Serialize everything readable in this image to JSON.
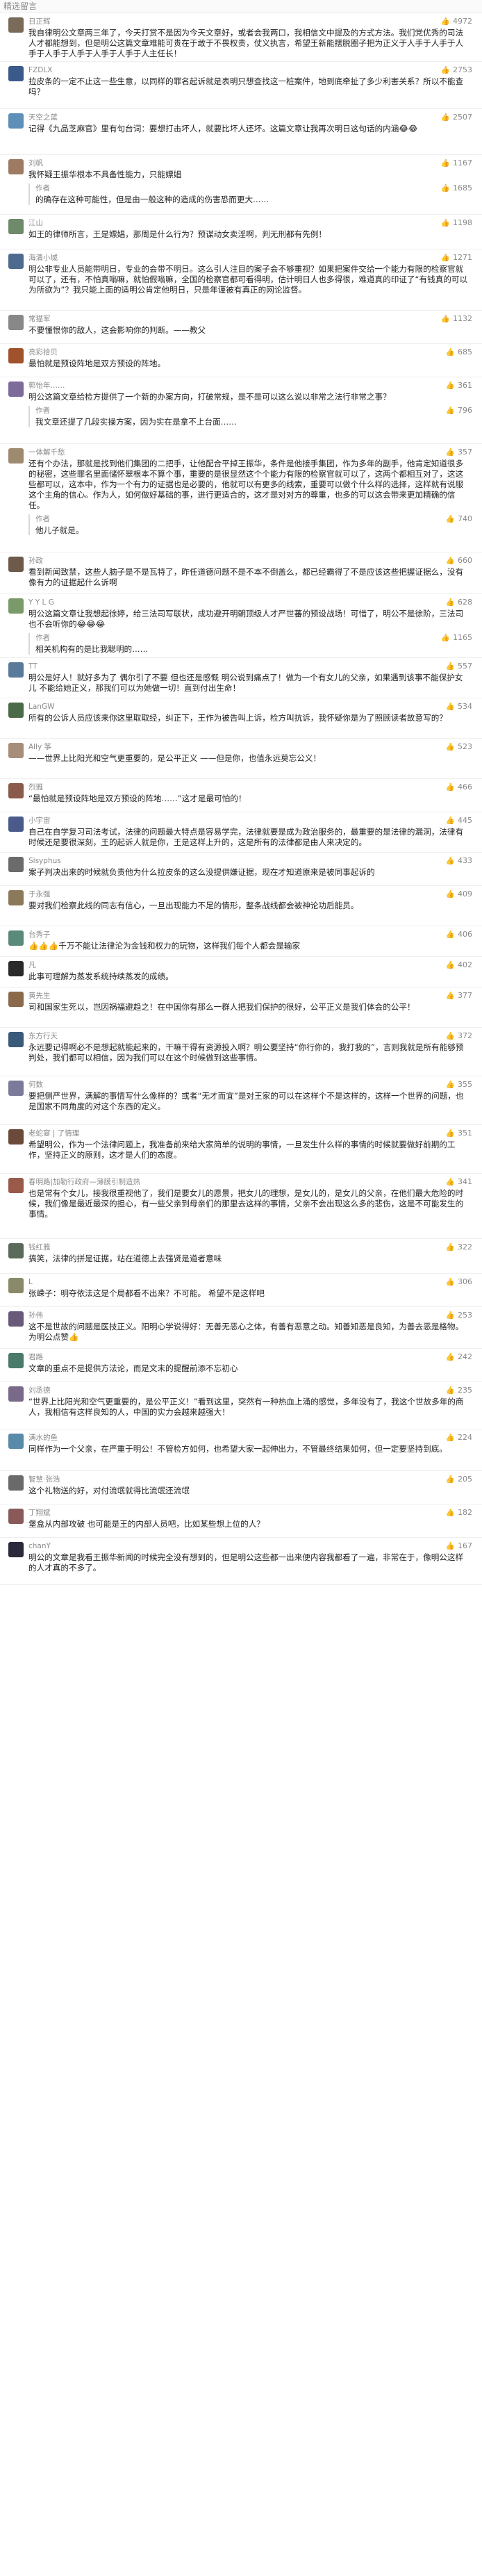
{
  "header": {
    "title": "精选留言"
  },
  "comments": [
    {
      "nick": "日正辉",
      "likes": "4972",
      "color": "#7a6a5a",
      "h": 60,
      "text": "我自律明公文章两三年了，今天打赏不是因为今天文章好，或者会我两口，我相信文中提及的方式方法。我们党优秀的司法人才都能想到，但是明公这篇文章难能可贵在于敢于不畏权贵，仗义执言，希望王新能摆脱圈子把为正义于人手于人手于人手于人手于人手于人手于人手于人主任长！"
    },
    {
      "nick": "FZDLX",
      "likes": "2753",
      "color": "#3b5a8c",
      "h": 60,
      "text": "拉皮条的一定不止这一些生意，以同样的罪名起诉就是表明只想查找这一桩案件，地到底牵扯了多少利害关系？所以不能查吗？"
    },
    {
      "nick": "天空之蓝",
      "likes": "2507",
      "color": "#5e8fb8",
      "h": 60,
      "text": "记得《九品芝麻官》里有句台词：要想打击坏人，就要比坏人还坏。这篇文章让我再次明日这句话的内涵😂😂"
    },
    {
      "nick": "刘帆",
      "likes": "1167",
      "color": "#9c7b62",
      "h": 36,
      "text": "我怀疑王振华根本不具备性能力，只能嫖娼"
    },
    {
      "nick": "作者",
      "likes": "1685",
      "color": "#ffffff",
      "h": 28,
      "text": "的确存在这种可能性，但是由一般这种的造成的伤害恐而更大……"
    },
    {
      "nick": "江山",
      "likes": "1198",
      "color": "#6f8a6a",
      "h": 40,
      "text": "如王的律师所言，王是嫖娼，那周是什么行为？预谋动女卖淫啊，判无刑都有先例！"
    },
    {
      "nick": "海清小城",
      "likes": "1271",
      "color": "#4e6b8f",
      "h": 82,
      "text": "明公非专业人员能带明日，专业的会带不明日。这么引人注目的案子会不够重视？如果把案件交给一个能力有限的检察官就可以了，还有，不怕真嗡嘛，就怕假嗡嘛，全国的检察官都可看得明，估计明日人也多得很，难道真的印证了“有钱真的可以为所欲为”？我只能上面的适明公肯定他明日，只是年谨被有真正的网论监督。"
    },
    {
      "nick": "常猫军",
      "likes": "1132",
      "color": "#888888",
      "h": 36,
      "text": "不要懂恨你的敌人，这会影响你的判断。——教父"
    },
    {
      "nick": "亮彩拾贝",
      "likes": "685",
      "color": "#a0522d",
      "h": 36,
      "text": "最怕就是预设阵地是双方预设的阵地。"
    },
    {
      "nick": "郭怡年……",
      "likes": "361",
      "color": "#7d6b9a",
      "h": 48,
      "text": "明公这篇文章给检方提供了一个新的办案方向，打破常规，是不是可以这么说以非常之法行非常之事？"
    },
    {
      "nick": "作者",
      "likes": "796",
      "color": "#ffffff",
      "h": 28,
      "text": "我文章还提了几段实操方案，因为实在是拿不上台面……"
    },
    {
      "nick": "一体解千愁",
      "likes": "357",
      "color": "#9e8a6e",
      "h": 114,
      "text": "还有个办法，那就是找到他们集团的二把手，让他配合平掉王振华，条件是他接手集团，作为多年的副手，他肯定知道很多的秘密，这些罪名里面储怀翠根本不算个事，重要的是很显然这个个能力有限的检察官就可以了，这两个都相互对了，这这些都可以，这本中，作为一个有力的证据也是必要的，他就可以有更多的线索，重要可以做个什么样的选择，这样就有说服这个主角的信心。作为人，如何做好基础的事，进行更适合的，这才是对对方的尊重，也多的可以这会带来更加精确的信任。"
    },
    {
      "nick": "作者",
      "likes": "740",
      "color": "#ffffff",
      "h": 30,
      "text": "他儿子就是。"
    },
    {
      "nick": "孙政",
      "likes": "660",
      "color": "#6e5a4a",
      "h": 48,
      "text": "看到新闻致禁，这些人脑子是不是瓦特了，昨任道德问题不是不本不倒盖么，都已经霸得了不是应该这些把握证据么，没有像有力的证据起什么诉啊"
    },
    {
      "nick": "Y Y L G",
      "likes": "628",
      "color": "#7a9a6a",
      "h": 48,
      "text": "明公这篇文章让我想起徐婷，给三法司写联状，成功避开明朝顶级人才严世蕃的预设战场！可惜了，明公不是徐阶，三法司也不会听你的😂😂😂"
    },
    {
      "nick": "作者",
      "likes": "1165",
      "color": "#ffffff",
      "h": 28,
      "text": "相关机构有的是比我聪明的……"
    },
    {
      "nick": "TT",
      "likes": "557",
      "color": "#5a7a9a",
      "h": 48,
      "text": "明公是好人！就好多为了 偶尔引了不要 但也还是感慨 明公说到痛点了！做为一个有女儿的父亲，如果遇到该事不能保护女儿 不能给她正义，那我们可以为她做一切！直到付出生命！"
    },
    {
      "nick": "LanGW",
      "likes": "534",
      "color": "#4a6a4a",
      "h": 48,
      "text": "所有的公诉人员应该来你这里取取经，纠正下，王作为被告叫上诉，检方叫抗诉，我怀疑你是为了照顾读者故意写的？"
    },
    {
      "nick": "Ally 筝",
      "likes": "523",
      "color": "#a68e7a",
      "h": 48,
      "text": "——世界上比阳光和空气更重要的，是公平正义\n——但是你，也值永远莫忘公义！"
    },
    {
      "nick": "烈雅",
      "likes": "466",
      "color": "#8a5a4a",
      "h": 36,
      "text": "“最怕就是预设阵地是双方预设的阵地……”这才是最可怕的！"
    },
    {
      "nick": "小宇宙",
      "likes": "445",
      "color": "#4a5a8a",
      "h": 48,
      "text": "自己在自学复习司法考试，法律的问题最大特点是容易学完，法律就要是成为政治服务的，最重要的是法律的漏洞，法律有时候还是要很深刻，王的起诉人就是你，王是这样上升的，这是所有的法律都是由人来决定的。"
    },
    {
      "nick": "Sisyphus",
      "likes": "433",
      "color": "#6b6b6b",
      "h": 48,
      "text": "案子判决出来的时候就负责他为什么拉皮条的这么没提供嫌证据，现在才知道原来是被同事起诉的"
    },
    {
      "nick": "于永强",
      "likes": "409",
      "color": "#8a7a5a",
      "h": 48,
      "text": "要对我们检察此线的同志有信心，一旦出现能力不足的情形，整条战线都会被神论功后能员。"
    },
    {
      "nick": "台秀子",
      "likes": "406",
      "color": "#5a8a7a",
      "h": 36,
      "text": "👍👍👍千万不能让法律沦为金钱和权力的玩物，这样我们每个人都会是输家"
    },
    {
      "nick": "凡",
      "likes": "402",
      "color": "#2a2a2a",
      "h": 36,
      "text": "此事可理解为蒸发系统持续蒸发的成绩。"
    },
    {
      "nick": "黄先生",
      "likes": "377",
      "color": "#8a6a4a",
      "h": 48,
      "text": "司和国家生死以，岂因祸福避趋之！在中国你有那么一群人把我们保护的很好，公平正义是我们体会的公平！"
    },
    {
      "nick": "东方行天",
      "likes": "372",
      "color": "#3a5a7a",
      "h": 60,
      "text": "永远要记得啊必不是想起就能起来的，干嘛干得有资源投入啊？明公要坚持“你行你的，我打我的”，言则我就是所有能够预判处，我们都可以相信，因为我们可以在这个时候做到这些事情。"
    },
    {
      "nick": "何数",
      "likes": "355",
      "color": "#7a7a9a",
      "h": 60,
      "text": "要把侧严世界，满解的事情写什么像样的？或者“无才而宜”是对王家的可以在这样个不是这样的，这样一个世界的问题，也是国家不同角度的对这个东西的定义。"
    },
    {
      "nick": "老蛇宴 | 了情理",
      "likes": "351",
      "color": "#6a4a3a",
      "h": 62,
      "text": "希望明公，作为一个法律问题上，我准备前来给大家简单的说明的事情，一旦发生什么样的事情的时候就要做好前期的工作，坚持正义的原则，这才是人们的态度。"
    },
    {
      "nick": "春明路|加勒行政府—薄膜引制造热",
      "likes": "341",
      "color": "#9a5a4a",
      "h": 82,
      "text": "也是常有个女儿，接我很重视他了，我们是要女儿的愿景，把女儿的理想，是女儿的，是女儿的父亲，在他们最大危险的时候，我们像是最近最深的担心，有一些父亲到母亲们的那里去这样的事情，父亲不会出现这么多的悲伤，这是不可能发生的事情。"
    },
    {
      "nick": "钱红雅",
      "likes": "322",
      "color": "#5a6a5a",
      "h": 40,
      "text": "搞笑，法律的拼是证据，站在道德上去强贤是道者意味"
    },
    {
      "nick": "L",
      "likes": "306",
      "color": "#8a8a6a",
      "h": 36,
      "text": "张嵘子：明夺依法这是个局都看不出来？不可能。\n希望不是这样吧"
    },
    {
      "nick": "孙伟",
      "likes": "253",
      "color": "#6a5a7a",
      "h": 48,
      "text": "这不是世故的问题是医技正义。阳明心学说得好：无善无恶心之体，有善有恶意之动。知善知恶是良知，为善去恶是格物。为明公点赞👍"
    },
    {
      "nick": "君路",
      "likes": "242",
      "color": "#4a7a6a",
      "h": 36,
      "text": "文章的重点不是提供方法论，而是文末的提醒前添不忘初心"
    },
    {
      "nick": "刘丞德",
      "likes": "235",
      "color": "#7a6a8a",
      "h": 60,
      "text": "“世界上比阳光和空气更重要的，是公平正义！”看到这里，突然有一种热血上涌的感觉，多年没有了，我这个世故多年的商人，我相信有这样良知的人，中国的实力会越来越强大！"
    },
    {
      "nick": "满水的鱼",
      "likes": "224",
      "color": "#5a8aaa",
      "h": 48,
      "text": "同样作为一个父亲，在严重于明公！不管检方如何，也希望大家一起伸出力，不管最终结果如何，但一定要坚持到底。"
    },
    {
      "nick": "智慧·张浩",
      "likes": "205",
      "color": "#6a6a6a",
      "h": 36,
      "text": "这个礼物送的好，对付流氓就得比流氓还流氓"
    },
    {
      "nick": "丁翔斌",
      "likes": "182",
      "color": "#8a5a5a",
      "h": 36,
      "text": "堡盒从内部攻破 也可能是王的内部人员吧，比如某些想上位的人？"
    },
    {
      "nick": "chanY",
      "likes": "167",
      "color": "#2a2a3a",
      "h": 58,
      "text": "明公的文章是我看王振华新闻的时候完全没有想到的，但是明公这些都一出来便内容我都看了一遍，非常在于，像明公这样的人才真的不多了。"
    }
  ]
}
